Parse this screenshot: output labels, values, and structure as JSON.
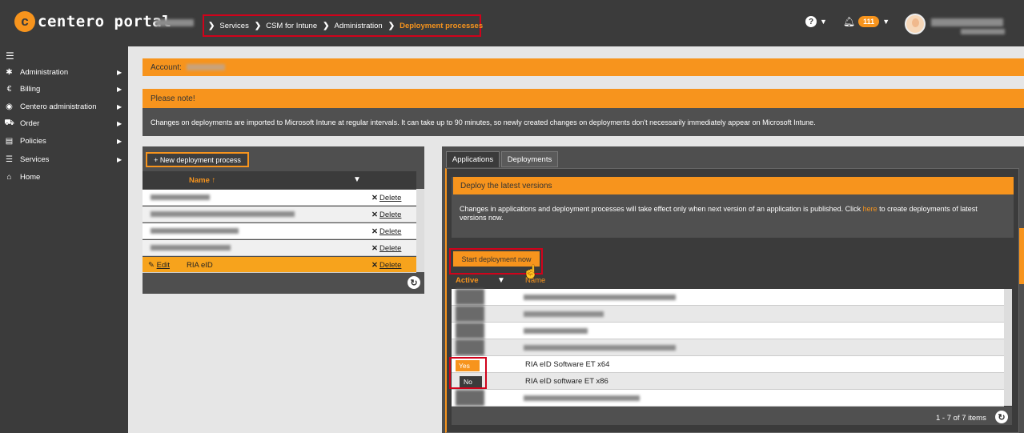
{
  "header": {
    "logo_mark": "c",
    "app_title": "centero portal",
    "breadcrumb": [
      "Services",
      "CSM for Intune",
      "Administration",
      "Deployment processes"
    ],
    "notification_count": "111",
    "help_icon": "help-circle-icon",
    "bell_icon": "bell-icon"
  },
  "sidebar": {
    "items": [
      {
        "label": "Administration",
        "icon": "gear-icon"
      },
      {
        "label": "Billing",
        "icon": "euro-icon"
      },
      {
        "label": "Centero administration",
        "icon": "centero-icon"
      },
      {
        "label": "Order",
        "icon": "cart-icon"
      },
      {
        "label": "Policies",
        "icon": "document-icon"
      },
      {
        "label": "Services",
        "icon": "server-icon"
      },
      {
        "label": "Home",
        "icon": "home-icon"
      }
    ]
  },
  "account": {
    "label": "Account:"
  },
  "notice": {
    "title": "Please note!",
    "text": "Changes on deployments are imported to Microsoft Intune at regular intervals. It can take up to 90 minutes, so newly created changes on deployments don't necessarily immediately appear on Microsoft Intune."
  },
  "left_panel": {
    "new_button": "+ New deployment process",
    "column_name": "Name",
    "sort_indicator": "↑",
    "delete_label": "Delete",
    "edit_label": "Edit",
    "selected_row_name": "RIA eID"
  },
  "right_panel": {
    "tabs": [
      "Applications",
      "Deployments"
    ],
    "deploy_title": "Deploy the latest versions",
    "deploy_text_before": "Changes in applications and deployment processes will take effect only when next version of an application is published. Click ",
    "deploy_link": "here",
    "deploy_text_after": " to create deployments of latest versions now.",
    "start_button": "Start deployment now",
    "column_active": "Active",
    "column_name": "Name",
    "rows": [
      {
        "active": "Yes",
        "name": "RIA eID Software ET x64"
      },
      {
        "active": "No",
        "name": "RIA eID software ET x86"
      }
    ],
    "pager": "1 - 7 of 7 items"
  }
}
